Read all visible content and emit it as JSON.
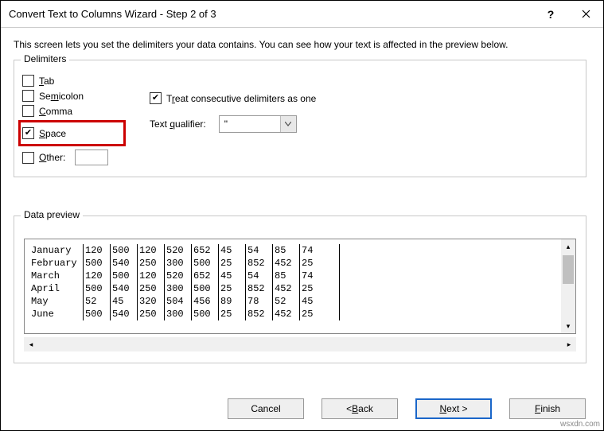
{
  "title": "Convert Text to Columns Wizard - Step 2 of 3",
  "desc": "This screen lets you set the delimiters your data contains.  You can see how your text is affected in the preview below.",
  "delimiters": {
    "legend": "Delimiters",
    "tab": "Tab",
    "semicolon": "Semicolon",
    "comma": "Comma",
    "space": "Space",
    "other": "Other:",
    "treat": "Treat consecutive delimiters as one",
    "qualifier_label": "Text qualifier:",
    "qualifier_value": "\""
  },
  "state": {
    "tab": false,
    "semicolon": false,
    "comma": false,
    "space": true,
    "other": false,
    "treat": true
  },
  "preview": {
    "legend": "Data preview",
    "rows": [
      [
        "January",
        "120",
        "500",
        "120",
        "520",
        "652",
        "45",
        "54",
        "85",
        "74"
      ],
      [
        "February",
        "500",
        "540",
        "250",
        "300",
        "500",
        "25",
        "852",
        "452",
        "25"
      ],
      [
        "March",
        "120",
        "500",
        "120",
        "520",
        "652",
        "45",
        "54",
        "85",
        "74"
      ],
      [
        "April",
        "500",
        "540",
        "250",
        "300",
        "500",
        "25",
        "852",
        "452",
        "25"
      ],
      [
        "May",
        "52",
        "45",
        "320",
        "504",
        "456",
        "89",
        "78",
        "52",
        "45"
      ],
      [
        "June",
        "500",
        "540",
        "250",
        "300",
        "500",
        "25",
        "852",
        "452",
        "25"
      ]
    ]
  },
  "buttons": {
    "cancel": "Cancel",
    "back": "< Back",
    "next": "Next >",
    "finish": "Finish"
  },
  "watermark": "wsxdn.com"
}
